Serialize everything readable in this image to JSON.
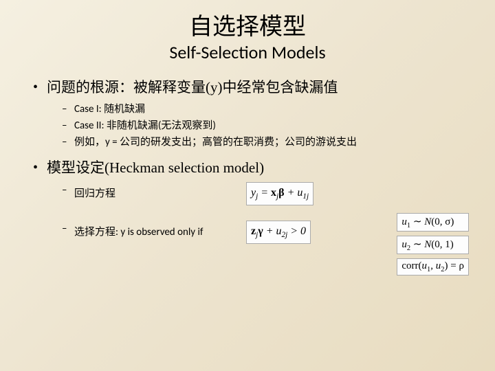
{
  "title": {
    "cn": "自选择模型",
    "en": "Self-Selection Models"
  },
  "bullets": [
    {
      "text": "问题的根源：被解释变量(y)中经常包含缺漏值",
      "sub": [
        "Case I: 随机缺漏",
        "Case II: 非随机缺漏(无法观察到)",
        "例如，y = 公司的研发支出；高管的在职消费；公司的游说支出"
      ]
    },
    {
      "text": "模型设定(Heckman selection model)",
      "sub": [
        "回归方程",
        "选择方程: y is observed only if"
      ]
    }
  ],
  "equations": {
    "regression": "yⱼ = xⱼβ + u₁ⱼ",
    "selection": "zⱼγ + u₂ⱼ > 0"
  },
  "side": {
    "u1": "u₁ ∼ N(0, σ)",
    "u2": "u₂ ∼ N(0, 1)",
    "corr": "corr(u₁, u₂) = ρ"
  }
}
